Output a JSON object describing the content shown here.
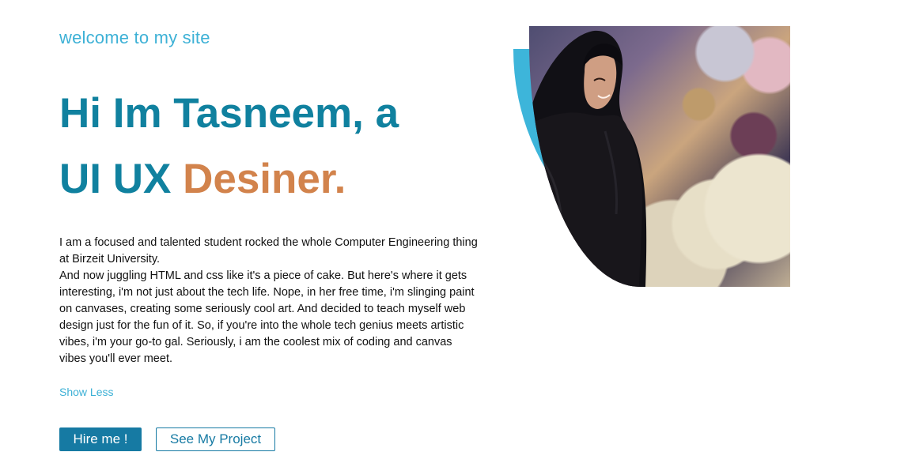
{
  "hero": {
    "welcome": "welcome to my site",
    "headline_line1": "Hi Im Tasneem, a",
    "headline_line2_prefix": "UI UX ",
    "headline_line2_accent": "Desiner."
  },
  "bio": {
    "paragraph1": "I am a focused and talented student rocked the whole Computer Engineering thing at Birzeit University.",
    "paragraph2": "And now juggling HTML and css like it's a piece of cake. But here's where it gets interesting, i'm not just about the tech life. Nope, in her free time, i'm slinging paint on canvases, creating some seriously cool art. And decided to teach myself web design just for the fun of it. So, if you're into the whole tech genius meets artistic vibes, i'm your go-to gal. Seriously, i am the coolest mix of coding and canvas vibes you'll ever meet.",
    "toggle_label": "Show Less"
  },
  "actions": {
    "hire_label": "Hire me !",
    "project_label": "See My Project"
  },
  "colors": {
    "primary": "#10819f",
    "accent": "#d2834c",
    "light_blue": "#3db1d6",
    "button_blue": "#167aa3"
  },
  "image": {
    "alt": "Portrait photo"
  }
}
